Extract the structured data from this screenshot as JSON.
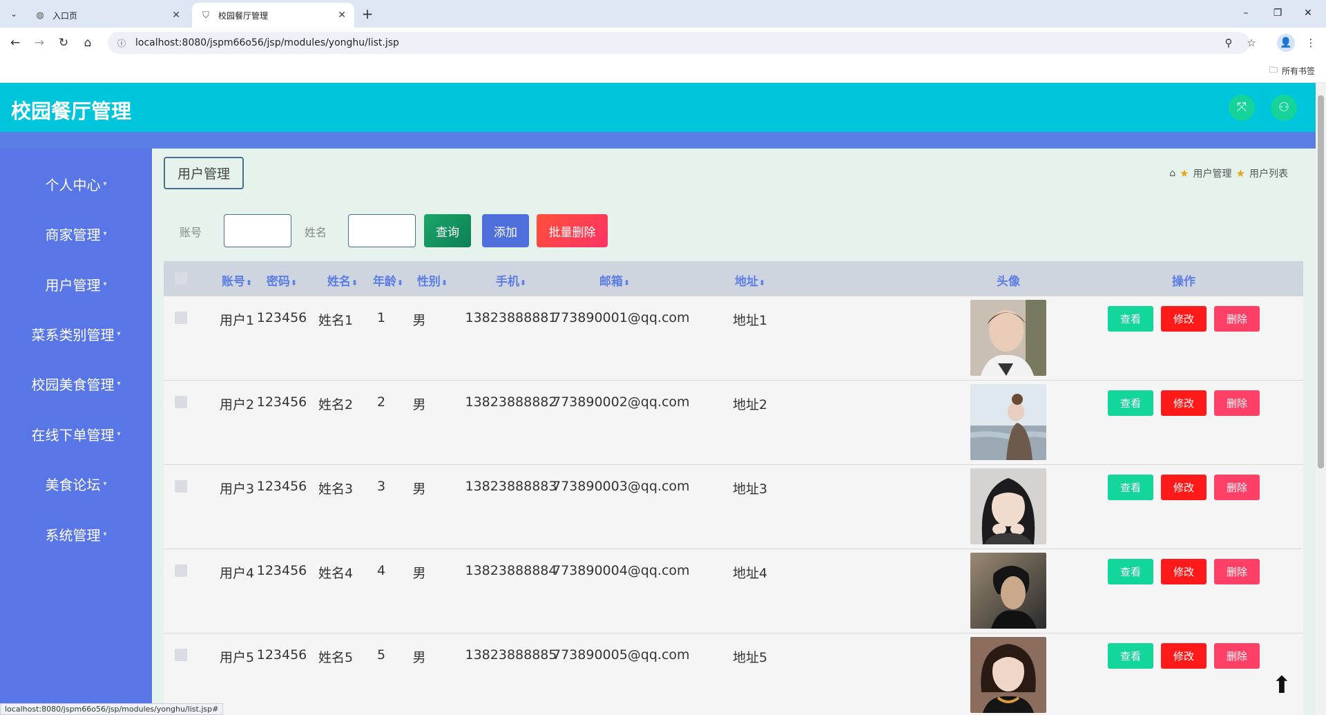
{
  "browser": {
    "tabs": [
      {
        "label": "入口页",
        "active": false
      },
      {
        "label": "校园餐厅管理",
        "active": true
      }
    ],
    "url": "localhost:8080/jspm66o56/jsp/modules/yonghu/list.jsp",
    "bookmarks_label": "所有书签",
    "status_url": "localhost:8080/jspm66o56/jsp/modules/yonghu/list.jsp#"
  },
  "header": {
    "title": "校园餐厅管理"
  },
  "sidebar": {
    "items": [
      {
        "label": "个人中心"
      },
      {
        "label": "商家管理"
      },
      {
        "label": "用户管理"
      },
      {
        "label": "菜系类别管理"
      },
      {
        "label": "校园美食管理"
      },
      {
        "label": "在线下单管理"
      },
      {
        "label": "美食论坛"
      },
      {
        "label": "系统管理"
      }
    ]
  },
  "page": {
    "tag": "用户管理",
    "breadcrumb": [
      "用户管理",
      "用户列表"
    ]
  },
  "search": {
    "account_label": "账号",
    "name_label": "姓名",
    "account_value": "",
    "name_value": "",
    "search_button": "查询",
    "add_button": "添加",
    "batch_delete_button": "批量删除"
  },
  "table": {
    "columns": [
      "账号",
      "密码",
      "姓名",
      "年龄",
      "性别",
      "手机",
      "邮箱",
      "地址",
      "头像",
      "操作"
    ],
    "sort_icon": "⬍",
    "actions": {
      "view": "查看",
      "edit": "修改",
      "delete": "删除"
    },
    "rows": [
      {
        "account": "用户1",
        "password": "123456",
        "name": "姓名1",
        "age": "1",
        "gender": "男",
        "phone": "13823888881",
        "email": "773890001@qq.com",
        "address": "地址1"
      },
      {
        "account": "用户2",
        "password": "123456",
        "name": "姓名2",
        "age": "2",
        "gender": "男",
        "phone": "13823888882",
        "email": "773890002@qq.com",
        "address": "地址2"
      },
      {
        "account": "用户3",
        "password": "123456",
        "name": "姓名3",
        "age": "3",
        "gender": "男",
        "phone": "13823888883",
        "email": "773890003@qq.com",
        "address": "地址3"
      },
      {
        "account": "用户4",
        "password": "123456",
        "name": "姓名4",
        "age": "4",
        "gender": "男",
        "phone": "13823888884",
        "email": "773890004@qq.com",
        "address": "地址4"
      },
      {
        "account": "用户5",
        "password": "123456",
        "name": "姓名5",
        "age": "5",
        "gender": "男",
        "phone": "13823888885",
        "email": "773890005@qq.com",
        "address": "地址5"
      }
    ]
  },
  "colors": {
    "header": "#00c6dc",
    "sidebar": "#5876e6",
    "content_bg": "#e6f3ec",
    "view_button": "#13d69a",
    "edit_button": "#ff1a1a",
    "delete_button": "#ff4066"
  }
}
